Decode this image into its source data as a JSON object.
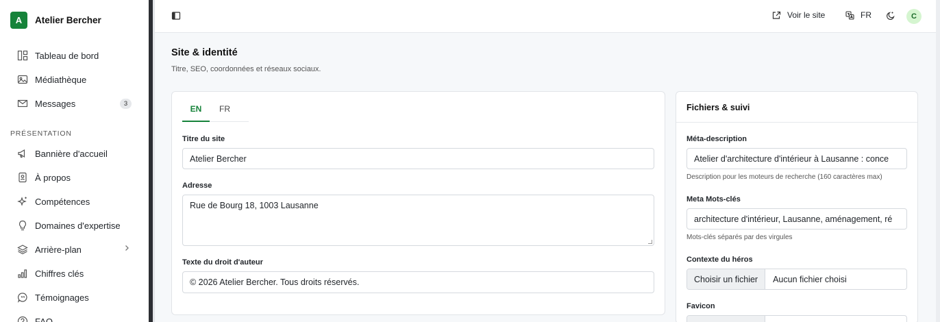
{
  "app": {
    "brand_initial": "A",
    "brand_name": "Atelier Bercher",
    "accent": "#16833a"
  },
  "sidebar": {
    "items": [
      {
        "label": "Tableau de bord",
        "icon": "dashboard-icon"
      },
      {
        "label": "Médiathèque",
        "icon": "image-icon"
      },
      {
        "label": "Messages",
        "icon": "mail-icon",
        "badge": "3"
      }
    ],
    "section_label": "PRÉSENTATION",
    "section_items": [
      {
        "label": "Bannière d'accueil",
        "icon": "megaphone-icon"
      },
      {
        "label": "À propos",
        "icon": "id-card-icon"
      },
      {
        "label": "Compétences",
        "icon": "sparkles-icon"
      },
      {
        "label": "Domaines d'expertise",
        "icon": "lightbulb-icon"
      },
      {
        "label": "Arrière-plan",
        "icon": "layers-icon",
        "has_submenu": true
      },
      {
        "label": "Chiffres clés",
        "icon": "bar-chart-icon"
      },
      {
        "label": "Témoignages",
        "icon": "quote-icon"
      },
      {
        "label": "FAQ",
        "icon": "help-circle-icon"
      }
    ]
  },
  "topbar": {
    "view_site": "Voir le site",
    "language": "FR",
    "avatar_initial": "C"
  },
  "page": {
    "title": "Site & identité",
    "subtitle": "Titre, SEO, coordonnées et réseaux sociaux."
  },
  "identity_form": {
    "tabs": [
      "EN",
      "FR"
    ],
    "active_tab": "EN",
    "site_title_label": "Titre du site",
    "site_title_value": "Atelier Bercher",
    "address_label": "Adresse",
    "address_value": "Rue de Bourg 18, 1003 Lausanne",
    "copyright_label": "Texte du droit d'auteur",
    "copyright_value": "© 2026 Atelier Bercher. Tous droits réservés."
  },
  "files_panel": {
    "title": "Fichiers & suivi",
    "meta_description_label": "Méta-description",
    "meta_description_value": "Atelier d'architecture d'intérieur à Lausanne : conce",
    "meta_description_help": "Description pour les moteurs de recherche (160 caractères max)",
    "meta_keywords_label": "Meta Mots-clés",
    "meta_keywords_value": "architecture d'intérieur, Lausanne, aménagement, ré",
    "meta_keywords_help": "Mots-clés séparés par des virgules",
    "hero_context_label": "Contexte du héros",
    "file_button": "Choisir un fichier",
    "file_status": "Aucun fichier choisi",
    "favicon_label": "Favicon"
  }
}
